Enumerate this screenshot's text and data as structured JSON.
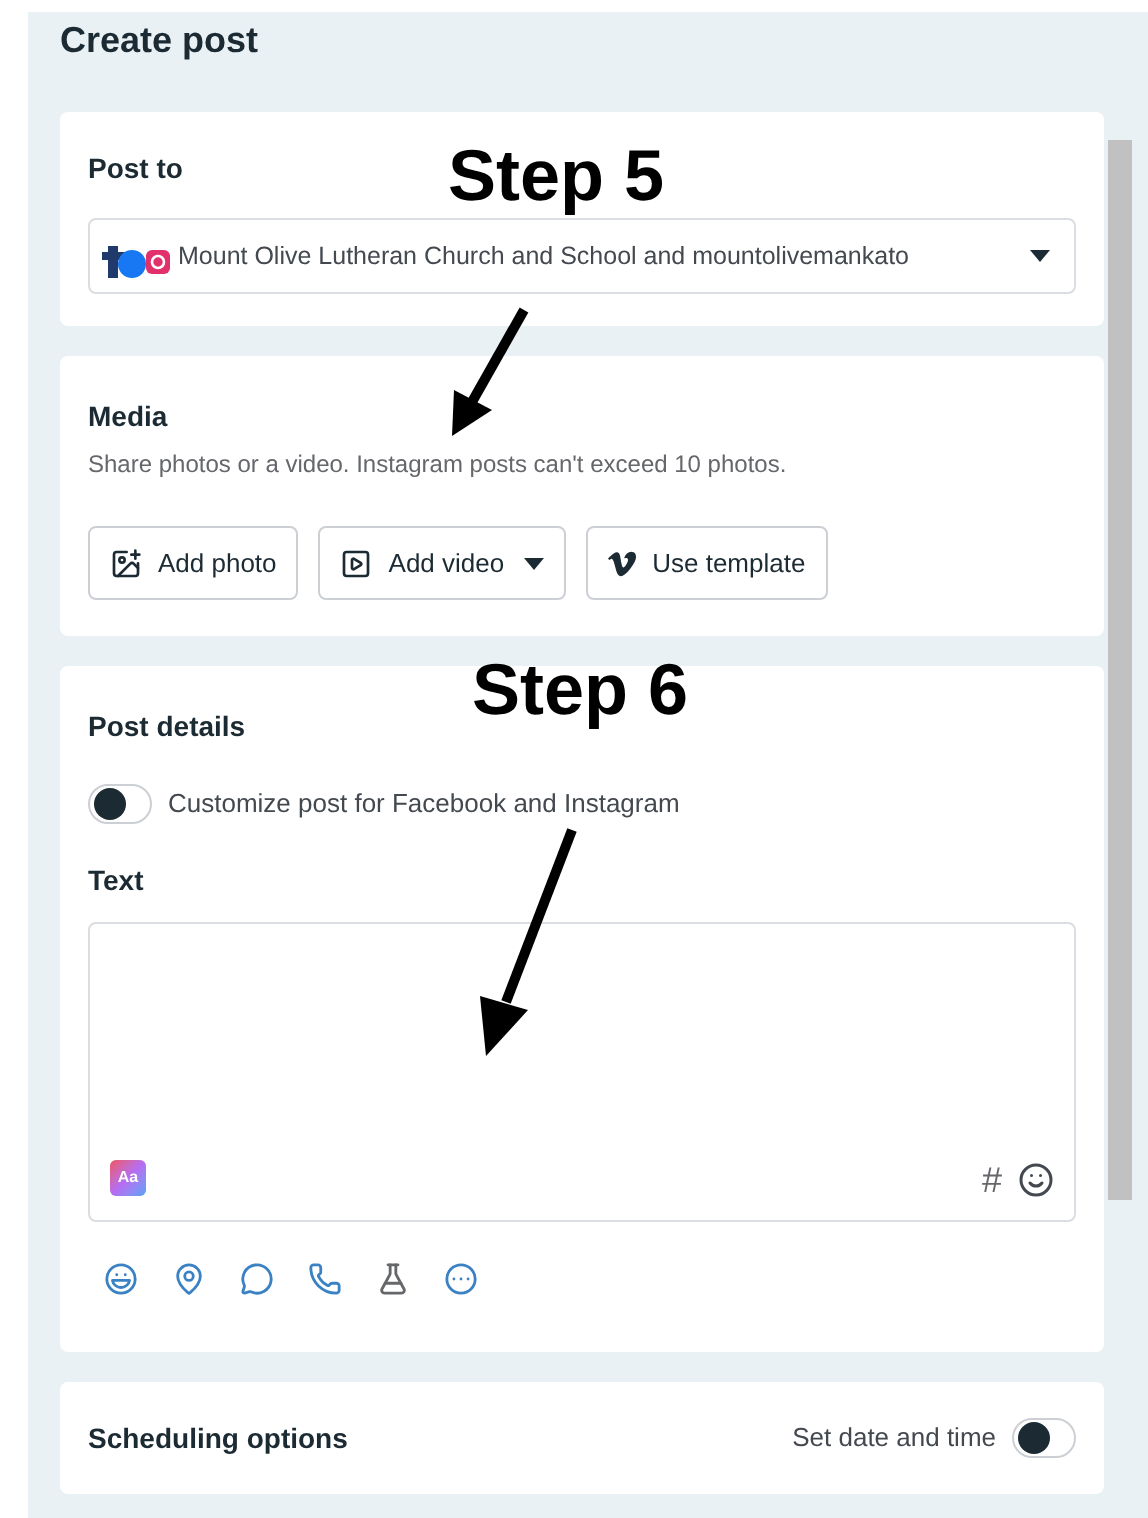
{
  "title": "Create post",
  "post_to": {
    "heading": "Post to",
    "account": "Mount Olive Lutheran Church and School and mountolivemankato"
  },
  "media": {
    "heading": "Media",
    "description": "Share photos or a video. Instagram posts can't exceed 10 photos.",
    "buttons": [
      {
        "kind": "photo",
        "label": "Add photo"
      },
      {
        "kind": "video",
        "label": "Add video"
      },
      {
        "kind": "template",
        "label": "Use template"
      }
    ]
  },
  "post_details": {
    "heading": "Post details",
    "customize": {
      "label": "Customize post for Facebook and Instagram",
      "on": false
    },
    "text_label": "Text",
    "format_button": "Aa",
    "hashtag": "#",
    "tools": [
      {
        "kind": "feeling"
      },
      {
        "kind": "location"
      },
      {
        "kind": "messenger"
      },
      {
        "kind": "whatsapp"
      },
      {
        "kind": "test"
      },
      {
        "kind": "more"
      }
    ]
  },
  "scheduling": {
    "heading": "Scheduling options",
    "toggle_label": "Set date and time",
    "on": false
  },
  "annotations": [
    {
      "label": "Step 5"
    },
    {
      "label": "Step 6"
    }
  ]
}
